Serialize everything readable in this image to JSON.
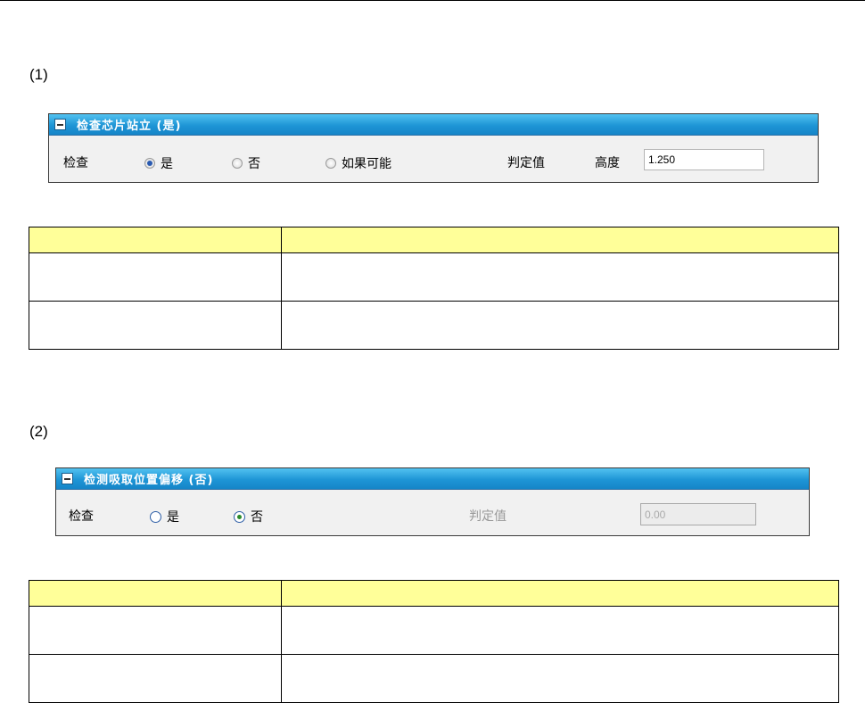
{
  "sections": [
    {
      "label": "(1)",
      "panel": {
        "title": "检查芯片站立 (是)",
        "check_label": "检查",
        "options": [
          {
            "label": "是",
            "checked": true
          },
          {
            "label": "否",
            "checked": false
          },
          {
            "label": "如果可能",
            "checked": false
          }
        ],
        "judge_label": "判定值",
        "height_label": "高度",
        "height_value": "1.250"
      },
      "table": {
        "headers": [
          "",
          ""
        ],
        "rows": [
          [
            "",
            ""
          ],
          [
            "",
            ""
          ]
        ]
      }
    },
    {
      "label": "(2)",
      "panel": {
        "title": "检测吸取位置偏移 (否)",
        "check_label": "检查",
        "options": [
          {
            "label": "是",
            "checked": false
          },
          {
            "label": "否",
            "checked": true
          }
        ],
        "judge_label": "判定值",
        "judge_value": "0.00"
      },
      "table": {
        "headers": [
          "",
          ""
        ],
        "rows": [
          [
            "",
            ""
          ],
          [
            "",
            ""
          ]
        ]
      }
    }
  ],
  "colors": {
    "header_blue": "#1e95d6",
    "table_header_yellow": "#ffff99"
  }
}
